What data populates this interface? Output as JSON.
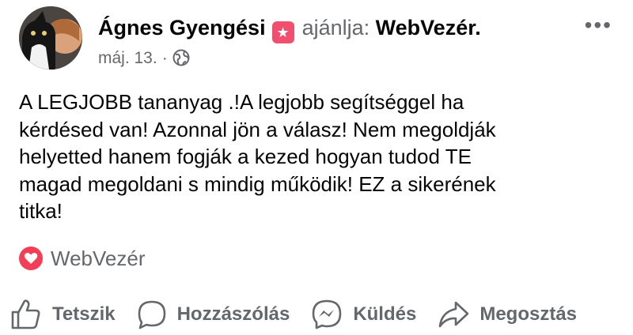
{
  "post": {
    "author": "Ágnes Gyengési",
    "verb": "ajánlja:",
    "page": "WebVezér",
    "trailing_dot": ".",
    "date": "máj. 13.",
    "separator": "·",
    "more_label": "•••",
    "text": "A LEGJOBB tananyag .!A legjobb segítséggel ha\nkérdésed van! Azonnal jön a válasz! Nem megoldják\nhelyetted hanem fogják a kezed hogyan tudod TE\nmagad megoldani s mindig működik!  EZ  a sikerének\ntitka!",
    "reaction_target": "WebVezér"
  },
  "actions": {
    "like": "Tetszik",
    "comment": "Hozzászólás",
    "send": "Küldés",
    "share": "Megosztás"
  },
  "colors": {
    "text": "#050505",
    "secondary": "#65676b",
    "recommend_badge": "#f0506e",
    "love": "#f33e58"
  },
  "icons": [
    "recommend-star-icon",
    "globe-icon",
    "more-icon",
    "heart-icon",
    "like-icon",
    "comment-icon",
    "messenger-icon",
    "share-icon"
  ]
}
